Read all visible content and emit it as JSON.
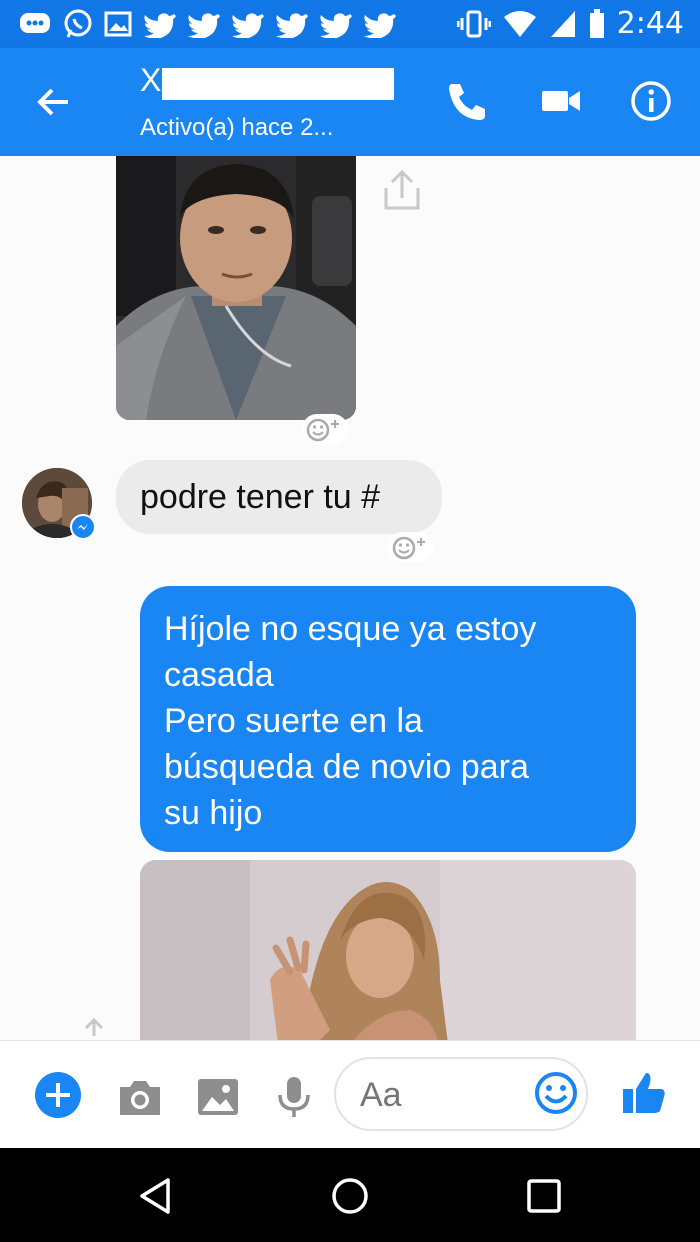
{
  "status_bar": {
    "time": "2:44",
    "icons": [
      "chat-notification-icon",
      "whatsapp-icon",
      "image-icon",
      "twitter-icon",
      "twitter-icon",
      "twitter-icon",
      "twitter-icon",
      "twitter-icon",
      "twitter-icon",
      "vibrate-icon",
      "wifi-icon",
      "signal-icon",
      "battery-icon"
    ]
  },
  "header": {
    "contact_initial": "X",
    "presence": "Activo(a) hace 2...",
    "icons": [
      "back-arrow-icon",
      "phone-icon",
      "video-camera-icon",
      "info-icon"
    ]
  },
  "messages": {
    "incoming_text": "podre tener tu #",
    "outgoing_lines": [
      "Híjole no esque ya estoy",
      "casada",
      "Pero suerte en la",
      "búsqueda de novio para",
      "su hijo"
    ]
  },
  "composer": {
    "placeholder": "Aa",
    "icons": [
      "add-icon",
      "camera-icon",
      "gallery-icon",
      "microphone-icon",
      "emoji-icon",
      "thumbs-up-icon"
    ]
  },
  "colors": {
    "messenger_blue": "#1a86f3",
    "status_blue": "#1277e6",
    "incoming_bubble": "#ebebeb"
  }
}
